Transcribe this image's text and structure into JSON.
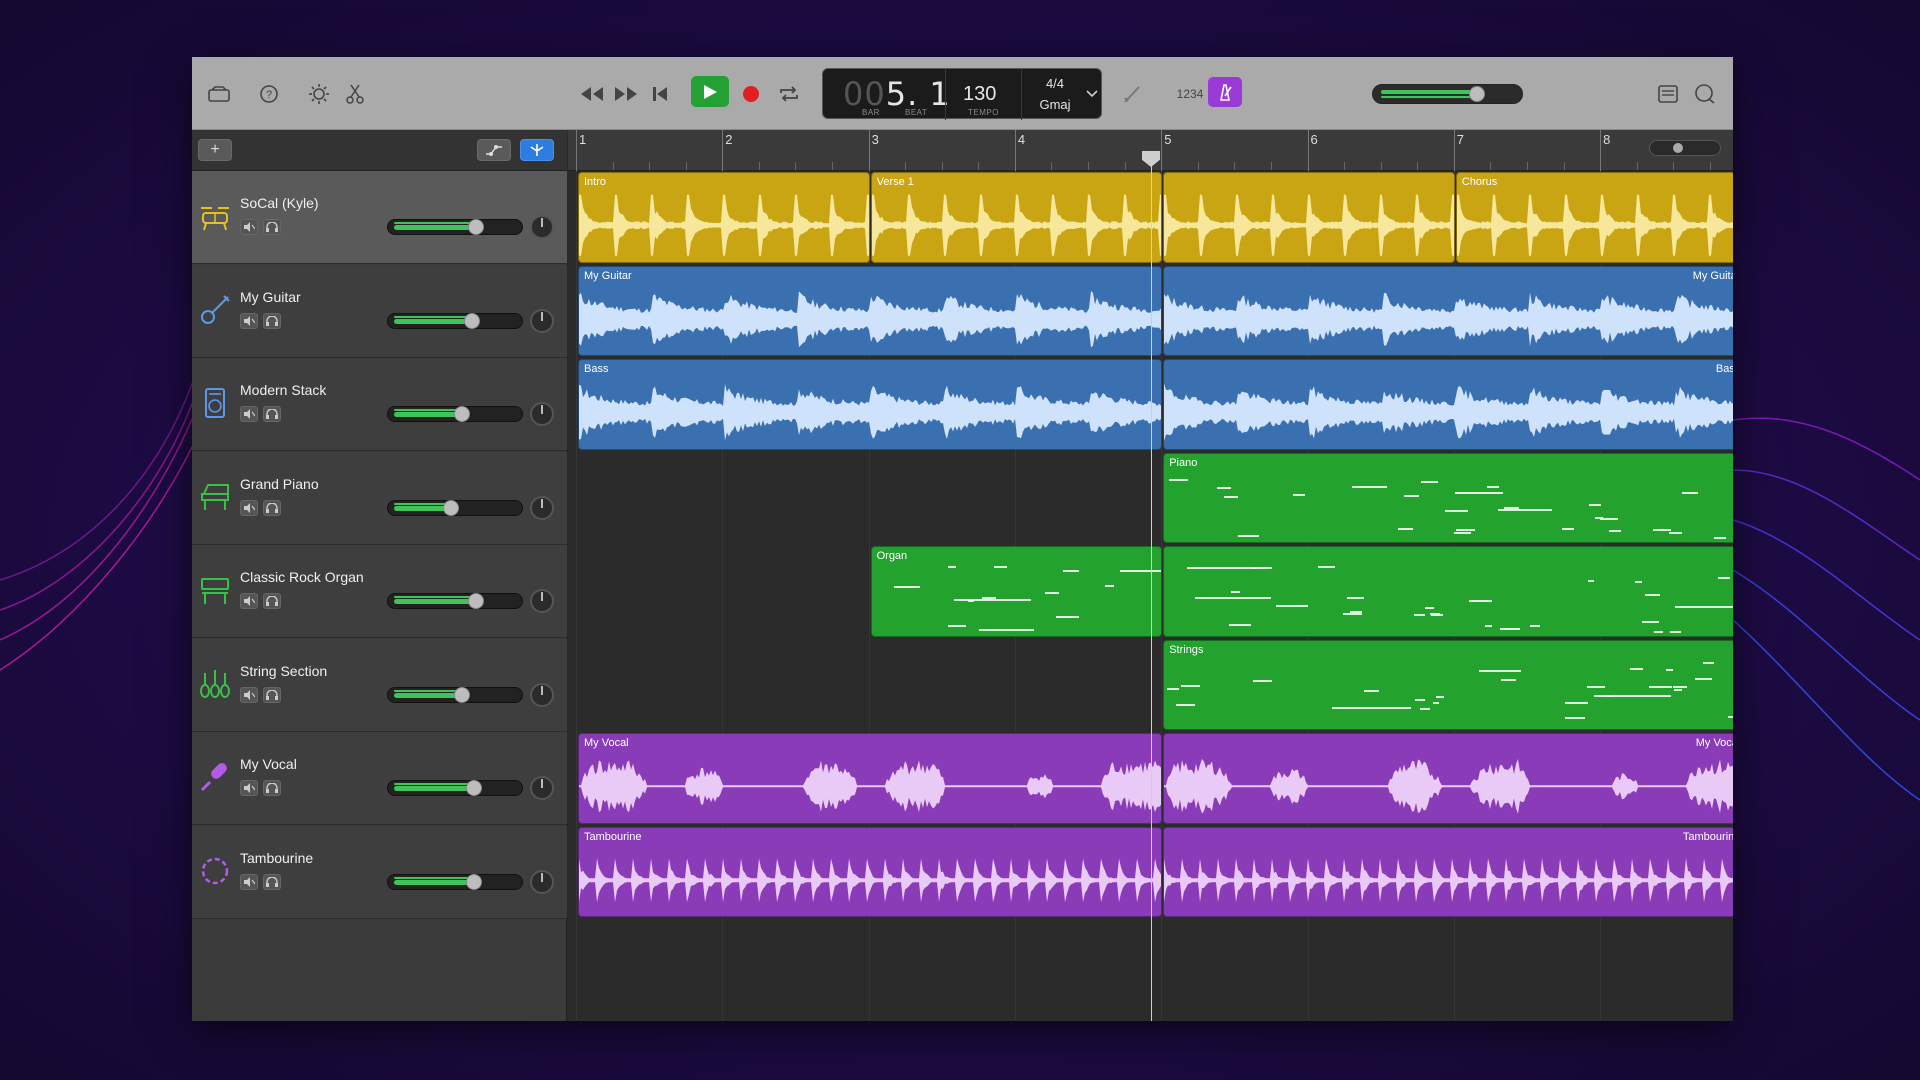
{
  "toolbar": {
    "lcd": {
      "bar_dim": "00",
      "bar": "5",
      "beat": "1",
      "bar_label": "BAR",
      "beat_label": "BEAT",
      "tempo": "130",
      "tempo_label": "TEMPO",
      "time_signature": "4/4",
      "key": "Gmaj"
    },
    "count_in_label": "1234",
    "master_volume": 0.68,
    "icons": [
      "library-icon",
      "help-icon",
      "smart-controls-icon",
      "editors-icon",
      "rewind-icon",
      "fast-forward-icon",
      "go-to-beginning-icon",
      "play-icon",
      "record-icon",
      "cycle-icon",
      "tuner-icon",
      "metronome-icon",
      "note-pad-icon",
      "loop-browser-icon"
    ]
  },
  "track_header": {
    "add_track_label": "+"
  },
  "ruler": {
    "bars": [
      "1",
      "2",
      "3",
      "4",
      "5",
      "6",
      "7",
      "8"
    ]
  },
  "tracks": [
    {
      "name": "SoCal (Kyle)",
      "icon": "drums-icon",
      "volume": 0.72,
      "color": "#c9a514"
    },
    {
      "name": "My Guitar",
      "icon": "guitar-icon",
      "volume": 0.68,
      "color": "#3a6fb0"
    },
    {
      "name": "Modern Stack",
      "icon": "amp-icon",
      "volume": 0.6,
      "color": "#3a6fb0"
    },
    {
      "name": "Grand Piano",
      "icon": "piano-icon",
      "volume": 0.5,
      "color": "#23a22e"
    },
    {
      "name": "Classic Rock Organ",
      "icon": "organ-icon",
      "volume": 0.72,
      "color": "#23a22e"
    },
    {
      "name": "String Section",
      "icon": "strings-icon",
      "volume": 0.6,
      "color": "#23a22e"
    },
    {
      "name": "My Vocal",
      "icon": "microphone-icon",
      "volume": 0.7,
      "color": "#8a3bb8"
    },
    {
      "name": "Tambourine",
      "icon": "tambourine-icon",
      "volume": 0.7,
      "color": "#8a3bb8"
    }
  ],
  "regions": {
    "intro": "Intro",
    "verse": "Verse 1",
    "chorus": "Chorus",
    "guitar": "My Guitar",
    "bass": "Bass",
    "piano": "Piano",
    "organ": "Organ",
    "strings": "Strings",
    "vocal": "My Vocal",
    "tambourine": "Tambourine"
  },
  "colors": {
    "drums": "#c9a514",
    "audio_blue": "#3a6fb0",
    "midi_green": "#23a22e",
    "audio_purple": "#8a3bb8",
    "fader_green": "#3ec45a"
  }
}
